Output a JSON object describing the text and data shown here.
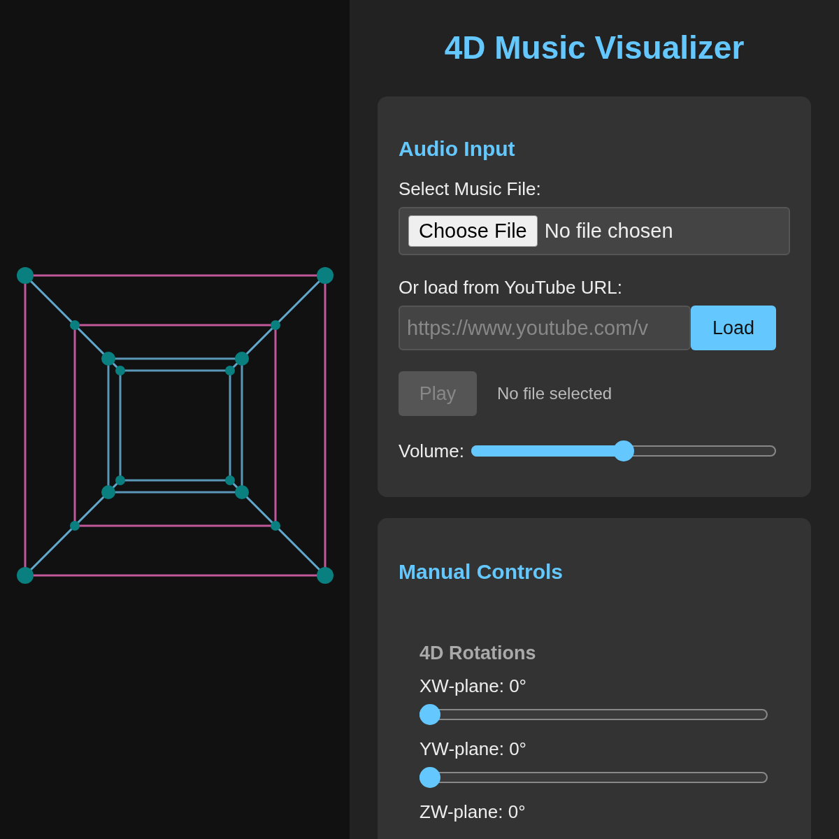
{
  "title": "4D Music Visualizer",
  "audio_input": {
    "heading": "Audio Input",
    "file_label": "Select Music File:",
    "file_button": "Choose File",
    "file_status": "No file chosen",
    "url_label": "Or load from YouTube URL:",
    "url_placeholder": "https://www.youtube.com/v",
    "load_button": "Load",
    "play_button": {
      "label": "Play",
      "disabled": true
    },
    "status": "No file selected",
    "volume": {
      "label": "Volume:",
      "level": 0.5
    }
  },
  "manual_controls": {
    "heading": "Manual Controls",
    "subheading": "4D Rotations",
    "sliders": [
      {
        "label": "XW-plane: 0°",
        "level": 0
      },
      {
        "label": "YW-plane: 0°",
        "level": 0
      },
      {
        "label": "ZW-plane: 0°"
      }
    ]
  }
}
